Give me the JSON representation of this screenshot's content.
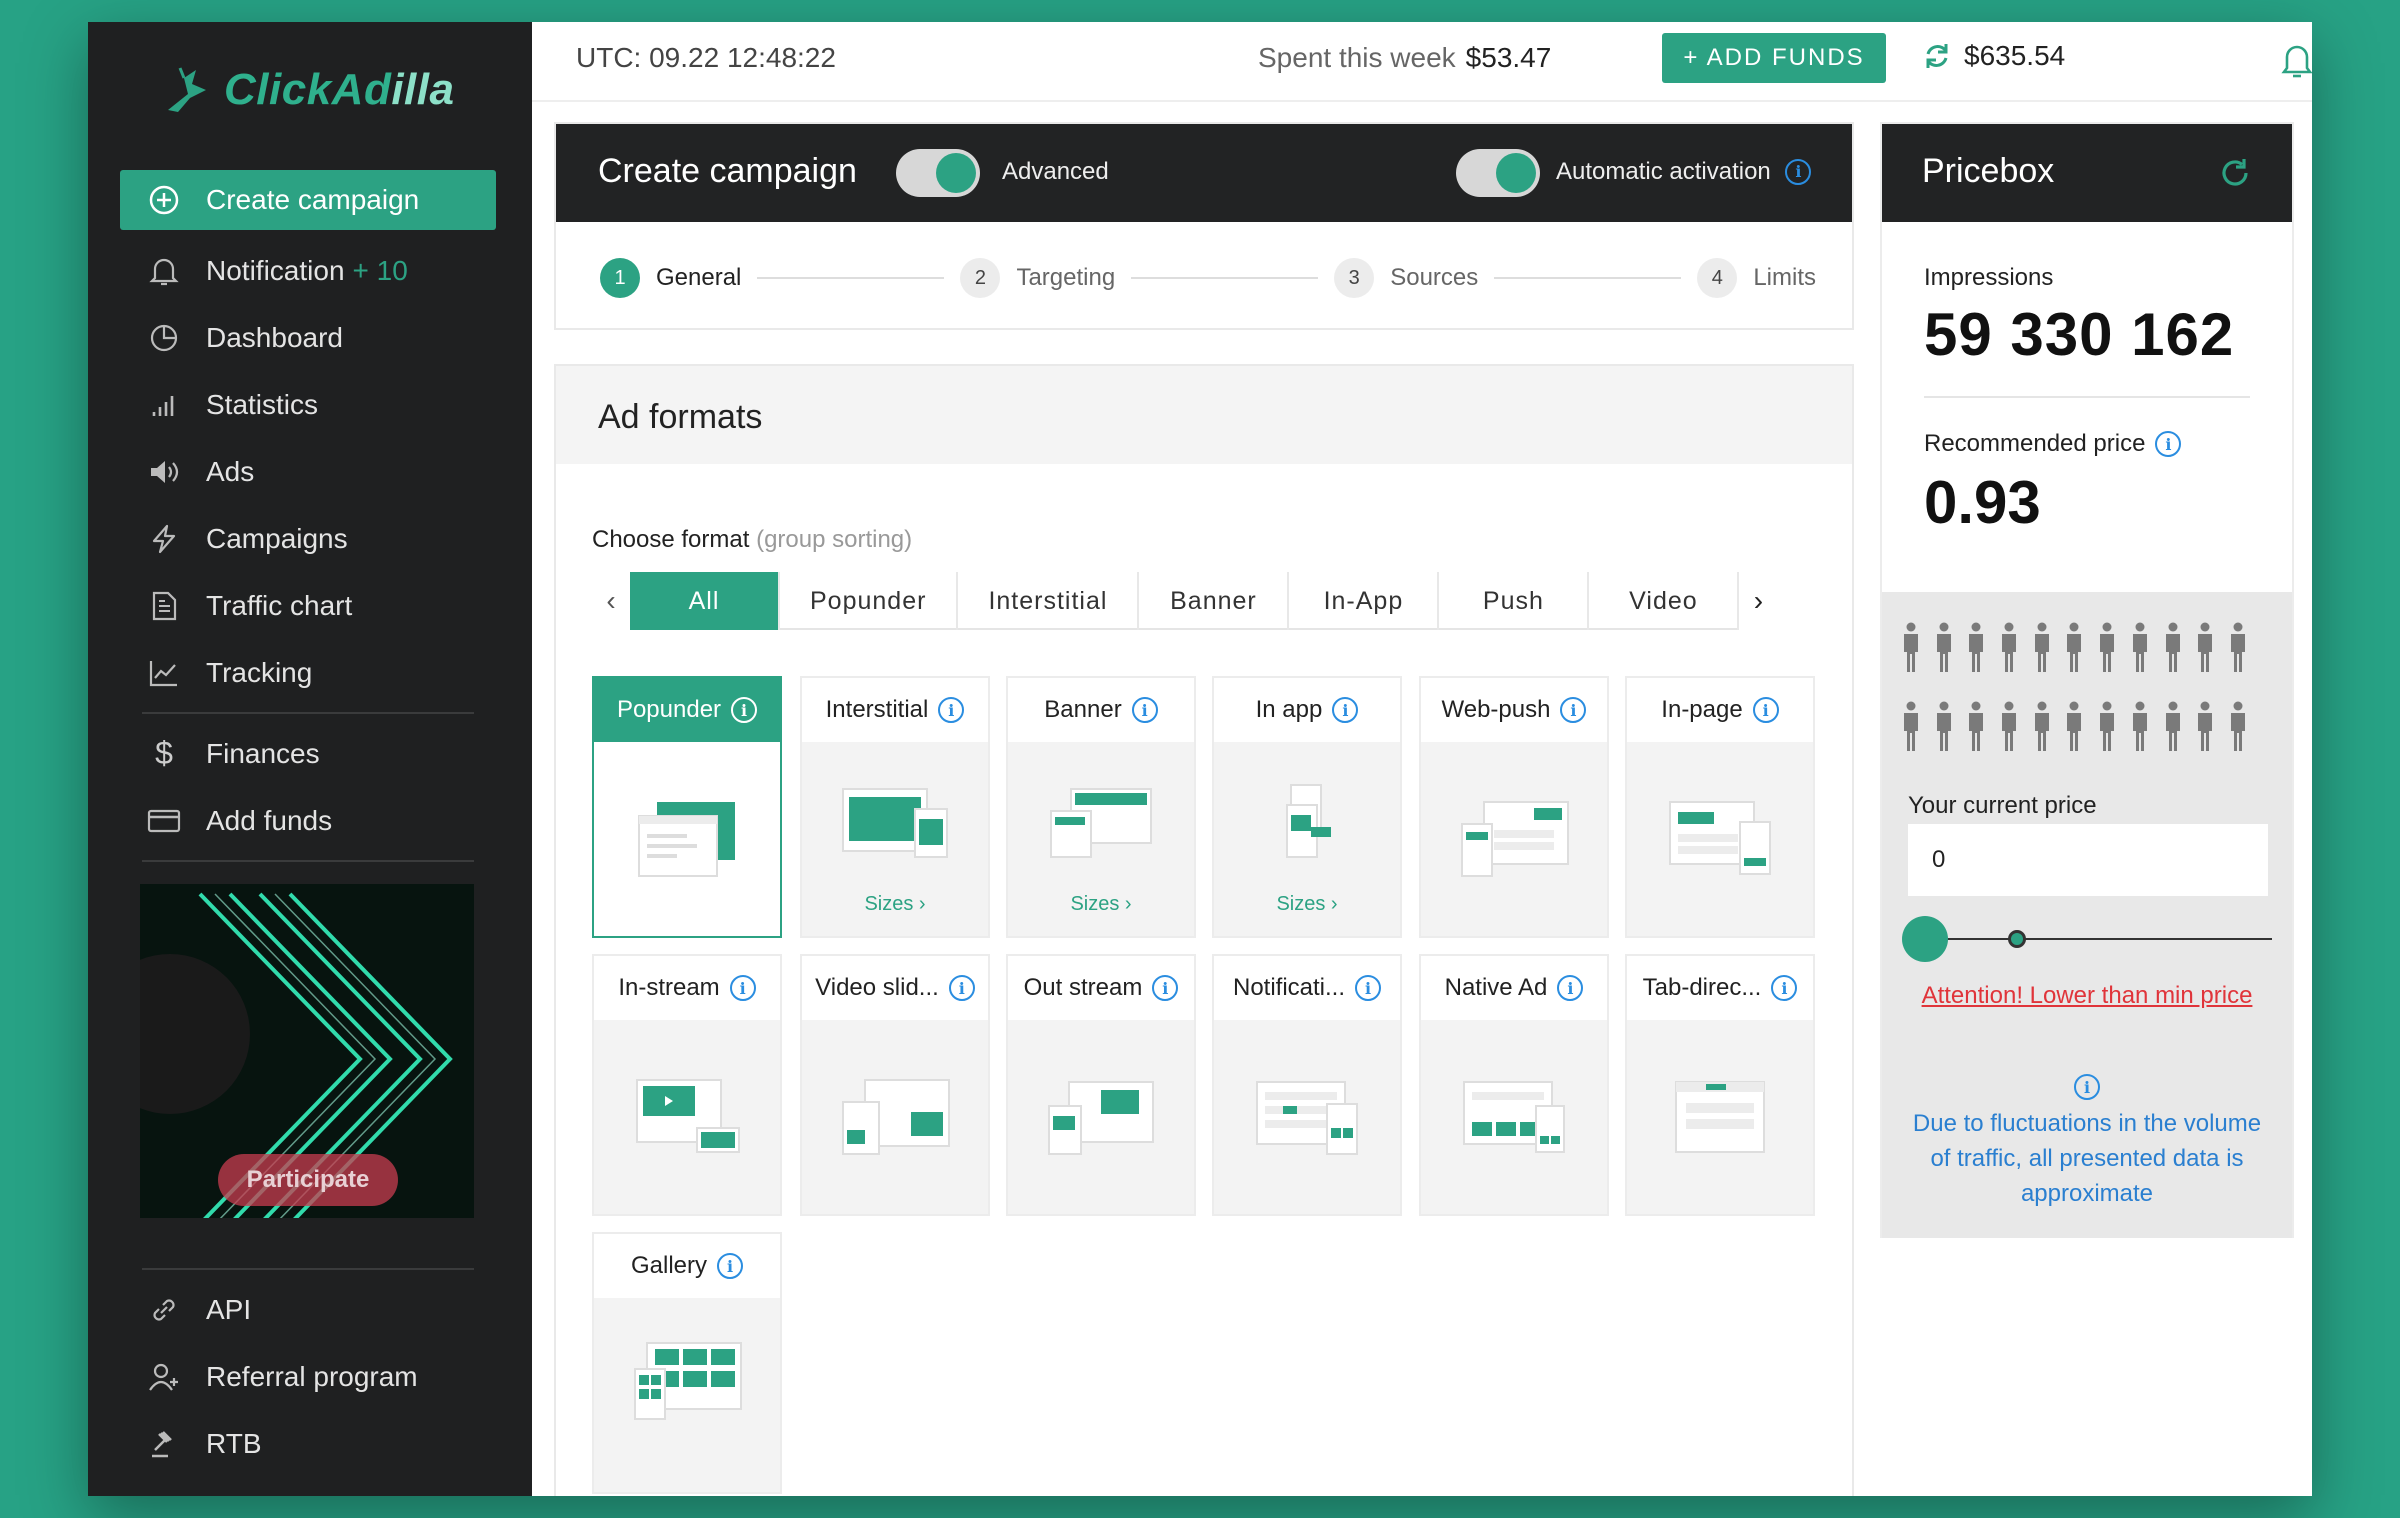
{
  "brand": {
    "name_a": "ClickAd",
    "name_b": "illa"
  },
  "sidebar": {
    "items": [
      {
        "label": "Create campaign",
        "icon": "plus-circle-icon"
      },
      {
        "label": "Notification",
        "badge": "+ 10",
        "icon": "bell-icon"
      },
      {
        "label": "Dashboard",
        "icon": "pie-chart-icon"
      },
      {
        "label": "Statistics",
        "icon": "signal-bars-icon"
      },
      {
        "label": "Ads",
        "icon": "speaker-icon"
      },
      {
        "label": "Campaigns",
        "icon": "lightning-icon"
      },
      {
        "label": "Traffic chart",
        "icon": "document-icon"
      },
      {
        "label": "Tracking",
        "icon": "line-chart-icon"
      },
      {
        "label": "Finances",
        "icon": "dollar-icon"
      },
      {
        "label": "Add funds",
        "icon": "card-icon"
      }
    ],
    "promo_button": "Participate",
    "bottom_items": [
      {
        "label": "API",
        "icon": "link-icon"
      },
      {
        "label": "Referral program",
        "icon": "user-plus-icon"
      },
      {
        "label": "RTB",
        "icon": "gavel-icon"
      }
    ]
  },
  "topbar": {
    "utc": "UTC: 09.22 12:48:22",
    "spent_label": "Spent this week",
    "spent_value": "$53.47",
    "add_funds": "+ ADD FUNDS",
    "balance": "$635.54"
  },
  "create_campaign": {
    "title": "Create campaign",
    "advanced_label": "Advanced",
    "auto_label": "Automatic activation",
    "steps": [
      {
        "num": "1",
        "label": "General"
      },
      {
        "num": "2",
        "label": "Targeting"
      },
      {
        "num": "3",
        "label": "Sources"
      },
      {
        "num": "4",
        "label": "Limits"
      }
    ]
  },
  "ad_formats": {
    "title": "Ad formats",
    "choose_label": "Choose format",
    "choose_hint": "(group sorting)",
    "tabs": [
      "All",
      "Popunder",
      "Interstitial",
      "Banner",
      "In-App",
      "Push",
      "Video"
    ],
    "cards": [
      {
        "label": "Popunder",
        "sizes": ""
      },
      {
        "label": "Interstitial",
        "sizes": "Sizes ›"
      },
      {
        "label": "Banner",
        "sizes": "Sizes ›"
      },
      {
        "label": "In app",
        "sizes": "Sizes ›"
      },
      {
        "label": "Web-push",
        "sizes": ""
      },
      {
        "label": "In-page",
        "sizes": ""
      },
      {
        "label": "In-stream",
        "sizes": ""
      },
      {
        "label": "Video slid...",
        "sizes": ""
      },
      {
        "label": "Out stream",
        "sizes": ""
      },
      {
        "label": "Notificati...",
        "sizes": ""
      },
      {
        "label": "Native Ad",
        "sizes": ""
      },
      {
        "label": "Tab-direc...",
        "sizes": ""
      },
      {
        "label": "Gallery",
        "sizes": ""
      }
    ]
  },
  "pricebox": {
    "title": "Pricebox",
    "impressions_label": "Impressions",
    "impressions_value": "59 330 162",
    "recommended_label": "Recommended price",
    "recommended_value": "0.93",
    "current_label": "Your current price",
    "current_value": "0",
    "attention": "Attention! Lower than min price",
    "note": "Due to fluctuations in the volume of traffic, all presented data is approximate"
  },
  "colors": {
    "accent": "#2ca283",
    "sidebar": "#1f2021",
    "info": "#2a8de0",
    "warning": "#e0343a"
  }
}
